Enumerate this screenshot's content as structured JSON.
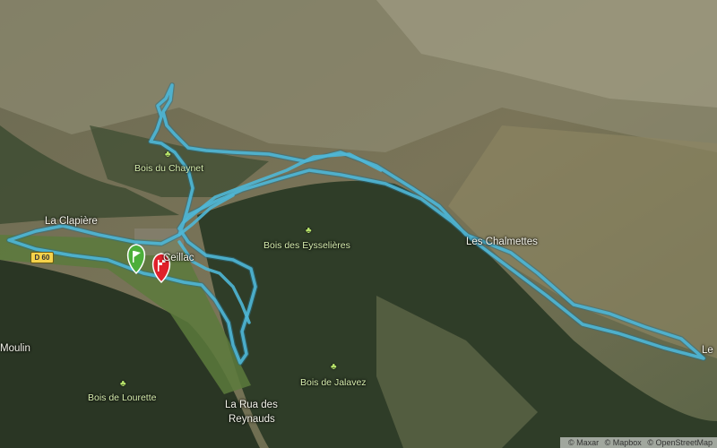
{
  "map": {
    "place_labels": [
      {
        "id": "la-clapiere",
        "text": "La Clapière"
      },
      {
        "id": "ceillac",
        "text": "Ceillac"
      },
      {
        "id": "les-chalmettes",
        "text": "Les Chalmettes"
      },
      {
        "id": "le",
        "text": "Le"
      },
      {
        "id": "la-rua",
        "text": "La Rua des"
      },
      {
        "id": "la-rua-2",
        "text": "Reynauds"
      },
      {
        "id": "moulin",
        "text": "Moulin"
      }
    ],
    "forest_labels": [
      {
        "id": "bois-chaynet",
        "text": "Bois du Chaynet"
      },
      {
        "id": "bois-eysselieres",
        "text": "Bois des Eysselières"
      },
      {
        "id": "bois-lourette",
        "text": "Bois de Lourette"
      },
      {
        "id": "bois-jalavez",
        "text": "Bois de Jalavez"
      }
    ],
    "road_shield": "D 60",
    "route_color": "#4fb7d6",
    "start_marker_color": "#4caf3a",
    "end_marker_color": "#e0202a"
  },
  "attribution": {
    "maxar": "© Maxar",
    "mapbox": "© Mapbox",
    "osm": "© OpenStreetMap"
  }
}
